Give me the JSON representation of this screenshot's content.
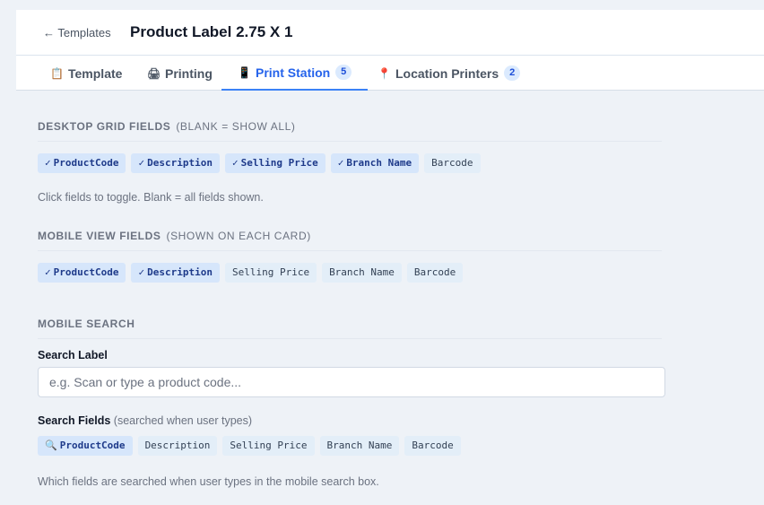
{
  "header": {
    "back_label": "← Templates",
    "title": "Product Label 2.75 X 1"
  },
  "tabs": [
    {
      "icon": "📋",
      "icon_name": "clipboard-icon",
      "label": "Template",
      "badge": "",
      "active": false
    },
    {
      "icon": "🖨",
      "icon_name": "printer-icon",
      "label": "Printing",
      "badge": "",
      "active": false
    },
    {
      "icon": "📱",
      "icon_name": "mobile-icon",
      "label": "Print Station",
      "badge": "5",
      "active": true
    },
    {
      "icon": "📍",
      "icon_name": "pin-icon",
      "label": "Location Printers",
      "badge": "2",
      "active": false
    }
  ],
  "desktop_grid": {
    "heading": "DESKTOP GRID FIELDS",
    "note": "(BLANK = SHOW ALL)",
    "fields": [
      {
        "label": "ProductCode",
        "selected": true
      },
      {
        "label": "Description",
        "selected": true
      },
      {
        "label": "Selling Price",
        "selected": true
      },
      {
        "label": "Branch Name",
        "selected": true
      },
      {
        "label": "Barcode",
        "selected": false
      }
    ],
    "help": "Click fields to toggle. Blank = all fields shown."
  },
  "mobile_view": {
    "heading": "MOBILE VIEW FIELDS",
    "note": "(SHOWN ON EACH CARD)",
    "fields": [
      {
        "label": "ProductCode",
        "selected": true
      },
      {
        "label": "Description",
        "selected": true
      },
      {
        "label": "Selling Price",
        "selected": false
      },
      {
        "label": "Branch Name",
        "selected": false
      },
      {
        "label": "Barcode",
        "selected": false
      }
    ]
  },
  "mobile_search": {
    "heading": "MOBILE SEARCH",
    "search_label": "Search Label",
    "search_placeholder": "e.g. Scan or type a product code...",
    "search_value": "",
    "fields_label": "Search Fields",
    "fields_sub": "(searched when user types)",
    "fields": [
      {
        "label": "ProductCode",
        "selected": true
      },
      {
        "label": "Description",
        "selected": false
      },
      {
        "label": "Selling Price",
        "selected": false
      },
      {
        "label": "Branch Name",
        "selected": false
      },
      {
        "label": "Barcode",
        "selected": false
      }
    ],
    "help": "Which fields are searched when user types in the mobile search box."
  },
  "marks": {
    "check": "✓",
    "search": "🔍"
  },
  "colors": {
    "accent": "#2563eb",
    "chip_on_bg": "#d6e6fb",
    "chip_off_bg": "#e3eef8",
    "page_bg": "#eef2f7"
  }
}
